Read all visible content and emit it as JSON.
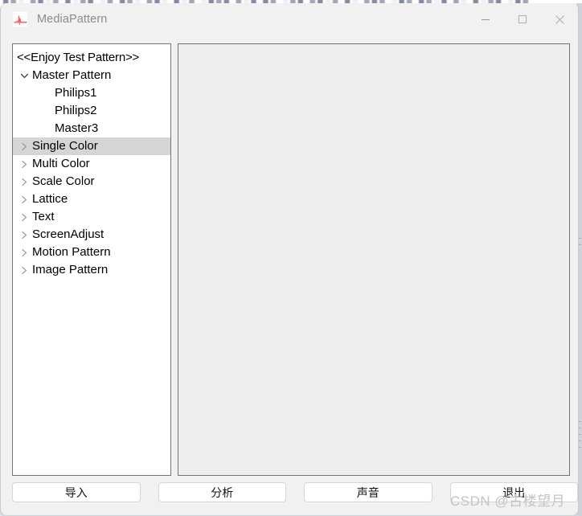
{
  "window": {
    "title": "MediaPattern",
    "app_icon": "waveform-icon",
    "accent_color": "#e8626e",
    "controls": {
      "minimize": "minimize-icon",
      "maximize": "maximize-icon",
      "close": "close-icon"
    }
  },
  "backdrop": {
    "text": "█▓░ ▓█░▓ █░▓█ ░▓ █▓░ ▓█░ █░▓ ░█▓█ ▓░█ █▓ ░▓█ ▓█░▓ █░ ▓█▓ ░█▓ █▓░█ ▓░ █░▓█ ░█▓"
  },
  "tree": {
    "name": "pattern-tree",
    "items": [
      {
        "label": "<<Enjoy Test Pattern>>",
        "level": "root",
        "twisty": "none",
        "selected": false
      },
      {
        "label": "Master Pattern",
        "level": "1",
        "twisty": "expanded",
        "selected": false
      },
      {
        "label": "Philips1",
        "level": "2",
        "twisty": "none",
        "selected": false
      },
      {
        "label": "Philips2",
        "level": "2",
        "twisty": "none",
        "selected": false
      },
      {
        "label": "Master3",
        "level": "2",
        "twisty": "none",
        "selected": false
      },
      {
        "label": "Single Color",
        "level": "1",
        "twisty": "collapsed",
        "selected": true
      },
      {
        "label": "Multi Color",
        "level": "1",
        "twisty": "collapsed",
        "selected": false
      },
      {
        "label": "Scale Color",
        "level": "1",
        "twisty": "collapsed",
        "selected": false
      },
      {
        "label": "Lattice",
        "level": "1",
        "twisty": "collapsed",
        "selected": false
      },
      {
        "label": "Text",
        "level": "1",
        "twisty": "collapsed",
        "selected": false
      },
      {
        "label": "ScreenAdjust",
        "level": "1",
        "twisty": "collapsed",
        "selected": false
      },
      {
        "label": "Motion Pattern",
        "level": "1",
        "twisty": "collapsed",
        "selected": false
      },
      {
        "label": "Image Pattern",
        "level": "1",
        "twisty": "collapsed",
        "selected": false
      }
    ]
  },
  "preview": {
    "name": "pattern-preview",
    "content": ""
  },
  "buttons": {
    "import": "导入",
    "analyze": "分析",
    "sound": "声音",
    "exit": "退出"
  },
  "watermark": {
    "text": "CSDN @古楼望月"
  },
  "colors": {
    "window_bg": "#f1f1f1",
    "tree_bg": "#ffffff",
    "tree_border": "#70757f",
    "selection_bg": "#d5d5d5",
    "preview_bg": "#eeeeee",
    "title_text": "#8b8b8b",
    "button_bg": "#ffffff",
    "button_border": "#d6d6d6",
    "watermark": "#c3c3c3"
  }
}
